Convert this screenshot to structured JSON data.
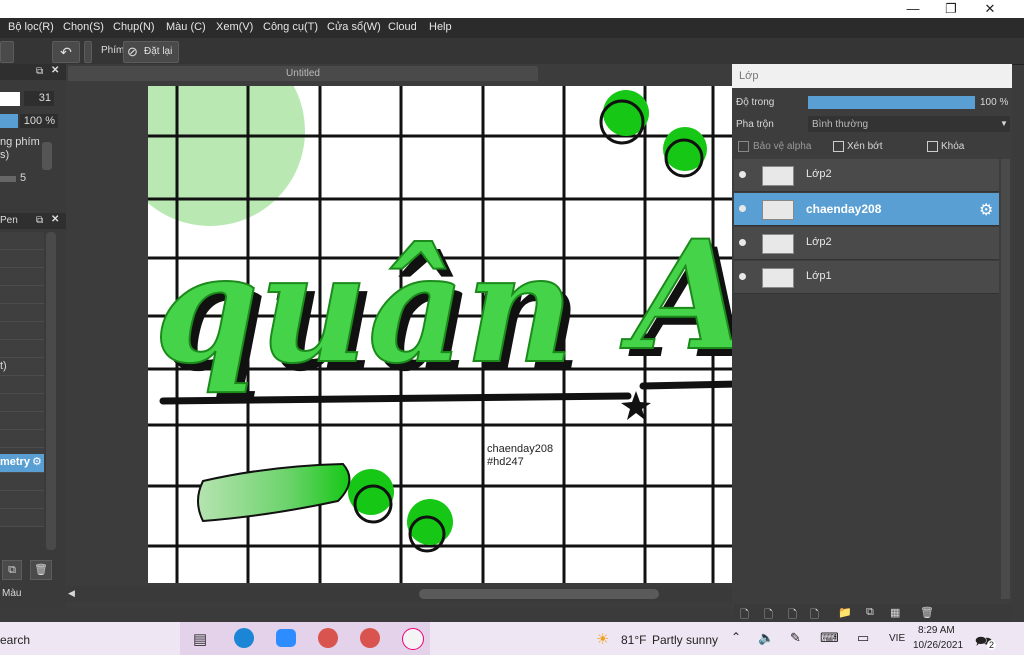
{
  "menu": [
    "Bộ lọc(R)",
    "Chọn(S)",
    "Chụp(N)",
    "Màu (C)",
    "Xem(V)",
    "Công cụ(T)",
    "Cửa sổ(W)",
    "Cloud",
    "Help"
  ],
  "toolbar": {
    "key_label": "Phím",
    "reset_label": "Đặt lại"
  },
  "left": {
    "brush_size": "31",
    "opacity": "100 %",
    "label_hotkey": "ng phím",
    "label_s": "s)",
    "value_5": "5",
    "panel2_title": "Pen",
    "row_t": "t)",
    "selected_tool": "metry"
  },
  "document": {
    "tab_title": "Untitled",
    "watermark_line1": "chaenday208",
    "watermark_line2": "#hd247"
  },
  "layers": {
    "panel_title": "Lớp",
    "opacity_label": "Độ trong",
    "opacity_value": "100 %",
    "blend_label": "Pha trộn",
    "blend_value": "Bình thường",
    "protect_alpha": "Bảo vệ alpha",
    "clip": "Xén bớt",
    "lock": "Khóa",
    "items": [
      {
        "name": "Lớp2"
      },
      {
        "name": "chaenday208"
      },
      {
        "name": "Lớp2"
      },
      {
        "name": "Lớp1"
      }
    ],
    "accent": "#5a9fd4"
  },
  "bottom_left": {
    "color_label": "Màu"
  },
  "taskbar": {
    "search": "earch",
    "weather_temp": "81°F",
    "weather_text": "Partly sunny",
    "lang": "VIE",
    "time": "8:29 AM",
    "date": "10/26/2021",
    "notifications": "2"
  },
  "colors": {
    "green": "#2ecc40",
    "light_green": "#a8e6a0"
  }
}
